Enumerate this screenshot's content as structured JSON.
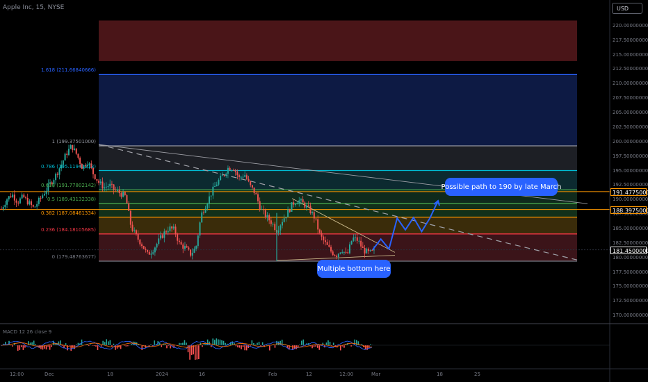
{
  "header": {
    "symbol": "Apple Inc, 15, NYSE",
    "currency_button": "USD"
  },
  "macd": {
    "title": "MACD 12 26 close 9"
  },
  "callouts": {
    "path": "Possible path to 190 by late March",
    "bottom": "Multiple bottom here"
  },
  "colors": {
    "background": "#000000",
    "up": "#26a69a",
    "down": "#ef5350",
    "accent": "#2962ff",
    "orange": "#ff9800"
  },
  "chart_data": {
    "type": "candlestick",
    "title": "Apple Inc, 15, NYSE",
    "y_axis": {
      "ylim": [
        170.5,
        221
      ],
      "tick_labels": [
        "220.00000000",
        "217.50000000",
        "215.00000000",
        "212.50000000",
        "210.00000000",
        "207.50000000",
        "205.00000000",
        "202.50000000",
        "200.00000000",
        "197.50000000",
        "195.00000000",
        "192.50000000",
        "190.00000000",
        "187.50000000",
        "185.00000000",
        "182.50000000",
        "180.00000000",
        "177.50000000",
        "175.00000000",
        "172.50000000",
        "170.00000000"
      ]
    },
    "x_axis": {
      "tick_labels": [
        "12:00",
        "Dec",
        "18",
        "2024",
        "16",
        "Feb",
        "12",
        "12:00",
        "Mar",
        "18",
        "25"
      ]
    },
    "fibonacci": [
      {
        "level": "1.618",
        "price": 211.66840666,
        "label": "1.618 (211.66840666)",
        "color": "#2962ff"
      },
      {
        "level": "1",
        "price": 199.37501,
        "label": "1 (199.37501000)",
        "color": "#9598a1"
      },
      {
        "level": "0.786",
        "price": 195.11941213,
        "label": "0.786 (195.11941213)",
        "color": "#00bcd4"
      },
      {
        "level": "0.618",
        "price": 191.77802142,
        "label": "0.618 (191.77802142)",
        "color": "#4caf50"
      },
      {
        "level": "0.5",
        "price": 189.43132338,
        "label": "0.5 (189.43132338)",
        "color": "#4caf50"
      },
      {
        "level": "0.382",
        "price": 187.08461334,
        "label": "0.382 (187.08461334)",
        "color": "#ff9800"
      },
      {
        "level": "0.236",
        "price": 184.18105685,
        "label": "0.236 (184.18105685)",
        "color": "#f23645"
      },
      {
        "level": "0",
        "price": 179.48763677,
        "label": "0 (179.48763677)",
        "color": "#787b86"
      }
    ],
    "price_tags": [
      {
        "value": "191.47750000",
        "price": 191.4775,
        "style": "outline"
      },
      {
        "value": "188.39750000",
        "price": 188.3975,
        "style": "outline"
      },
      {
        "value": "181.45000000",
        "price": 181.45,
        "style": "current"
      }
    ],
    "series": [
      {
        "name": "price",
        "close_path": [
          188.5,
          190.2,
          191,
          189.7,
          190.6,
          189.6,
          188.6,
          190,
          191.4,
          192.8,
          194.2,
          196,
          198,
          199.4,
          197.8,
          195.6,
          196.7,
          194.6,
          193.1,
          192.2,
          192.6,
          191.7,
          191.2,
          190.6,
          185.5,
          183.7,
          182.4,
          180.6,
          181.4,
          182.8,
          184.2,
          185.2,
          184.9,
          182.4,
          181.8,
          180.7,
          181.8,
          187.5,
          189.5,
          191.5,
          193.1,
          194.2,
          195.6,
          195.6,
          193.8,
          194.5,
          192.5,
          191.2,
          188.5,
          187.2,
          186.2,
          184.8,
          186.5,
          187.9,
          189.5,
          190,
          189.3,
          188.4,
          187,
          183.9,
          182.5,
          181.2,
          180.5,
          181.6,
          180.4,
          183.5,
          183.1,
          181.4,
          180.9,
          181.1
        ]
      },
      {
        "name": "projected path",
        "values": [
          181.45,
          183.3,
          181.6,
          186.9,
          184.9,
          187,
          184.6,
          186.9,
          189.9
        ]
      }
    ],
    "rectangles": [
      {
        "name": "upper red zone",
        "price_range": [
          214,
          221
        ],
        "color": "#4a1518"
      },
      {
        "name": "blue zone",
        "price_range": [
          199.37501,
          211.66840666
        ],
        "color": "#0d1a44"
      }
    ],
    "trendlines": [
      {
        "name": "long descending",
        "from": [
          199.6
        ],
        "to": [
          189.4
        ]
      },
      {
        "name": "dashed descending",
        "to": [
          179.7
        ]
      }
    ]
  }
}
